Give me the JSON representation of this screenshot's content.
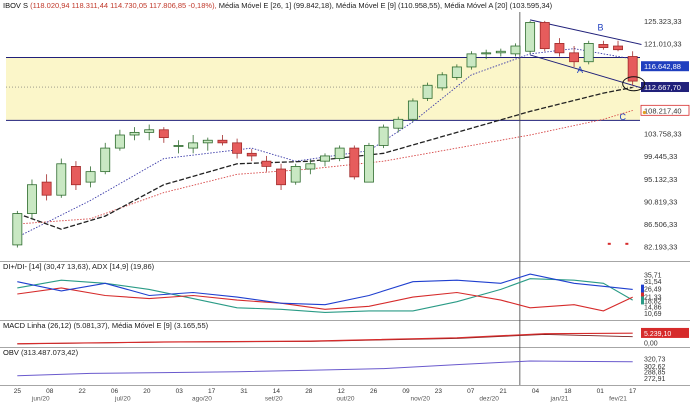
{
  "colors": {
    "up": "#c9e8c3",
    "up_edge": "#2e6b2e",
    "down": "#e65c5c",
    "down_edge": "#a12a2a",
    "zone": "#fbf6c9",
    "mme9": "#3a3aa8",
    "mme26": "#222222",
    "mma20": "#d64545",
    "di_plus": "#1f3fcf",
    "di_minus": "#d62b2b",
    "adx": "#2a9b86",
    "obv": "#6a5acd",
    "highlight_red": "#d62b2b",
    "highlight_blue": "#1f3fbf",
    "highlight_green": "#e6f2e0"
  },
  "legends": {
    "main": {
      "label": "IBOV S",
      "ohlc": "(118.020,94  118.311,44  114.730,05  117.806,85  -0,18%),",
      "mme26": "Média Móvel E [26, 1]  (99.842,18),",
      "mme9": "Média Móvel E [9]  (110.958,55),",
      "mma20": "Média Móvel A [20]  (103.595,34)"
    },
    "dmi": {
      "label": "DI+/DI- [14]",
      "di": "(30,47  13,63),",
      "adx": "ADX [14,9]  (19,86)"
    },
    "macd": {
      "label": "MACD Linha (26,12)",
      "line": "(5.081,37),",
      "mme": "Média Móvel E [9]  (3.165,55)"
    },
    "obv": {
      "label": "OBV",
      "value": "(313.487.073,42)"
    }
  },
  "axis": {
    "price_ticks": [
      "125.323,33",
      "121.010,33",
      "116.642,88",
      "112.667,70",
      "108.217,40",
      "103.758,33",
      "99.445,33",
      "95.132,33",
      "90.819,33",
      "86.506,33",
      "82.193,33"
    ],
    "dmi_ticks": [
      "35,71",
      "31,54",
      "26,49",
      "21,33",
      "18,82",
      "14,86",
      "10,69"
    ],
    "macd_ticks": [
      "5.239,10",
      "0,00"
    ],
    "obv_ticks": [
      "320,73",
      "302,62",
      "288,85",
      "272,91"
    ],
    "date_ticks": [
      "25",
      "08",
      "22",
      "06",
      "20",
      "03",
      "17",
      "31",
      "14",
      "28",
      "12",
      "26",
      "09",
      "23",
      "07",
      "21",
      "04",
      "18",
      "01",
      "17"
    ],
    "month_ticks": [
      "jun/20",
      "jul/20",
      "ago/20",
      "set/20",
      "out/20",
      "nov/20",
      "dez/20",
      "jan/21",
      "fev/21"
    ]
  },
  "annotations": {
    "wedge_a": "A",
    "wedge_b": "B",
    "wedge_c": "C"
  },
  "chart_data": {
    "type": "candlestick",
    "ylim": [
      80000,
      127000
    ],
    "highlight_levels": {
      "upper": 118300,
      "lower": 106300,
      "current": 112667.7,
      "blue": 116642.88,
      "red": 108217.4
    },
    "candles": [
      {
        "o": 82500,
        "h": 89000,
        "l": 82000,
        "c": 88500
      },
      {
        "o": 88500,
        "h": 95000,
        "l": 87500,
        "c": 94000
      },
      {
        "o": 94500,
        "h": 96000,
        "l": 91000,
        "c": 92000
      },
      {
        "o": 92000,
        "h": 99000,
        "l": 91500,
        "c": 98000
      },
      {
        "o": 97500,
        "h": 98500,
        "l": 93000,
        "c": 94000
      },
      {
        "o": 94500,
        "h": 97500,
        "l": 93500,
        "c": 96500
      },
      {
        "o": 96500,
        "h": 102000,
        "l": 96000,
        "c": 101000
      },
      {
        "o": 101000,
        "h": 104500,
        "l": 100500,
        "c": 103500
      },
      {
        "o": 103500,
        "h": 105000,
        "l": 102500,
        "c": 104000
      },
      {
        "o": 104000,
        "h": 105500,
        "l": 102500,
        "c": 104500
      },
      {
        "o": 104500,
        "h": 105000,
        "l": 102000,
        "c": 103000
      },
      {
        "o": 101500,
        "h": 102500,
        "l": 100000,
        "c": 101500
      },
      {
        "o": 101000,
        "h": 103500,
        "l": 100000,
        "c": 102000
      },
      {
        "o": 102000,
        "h": 103000,
        "l": 100500,
        "c": 102500
      },
      {
        "o": 102500,
        "h": 103500,
        "l": 101500,
        "c": 102000
      },
      {
        "o": 102000,
        "h": 102800,
        "l": 99000,
        "c": 100000
      },
      {
        "o": 100000,
        "h": 100800,
        "l": 98500,
        "c": 99500
      },
      {
        "o": 98500,
        "h": 99500,
        "l": 96500,
        "c": 97500
      },
      {
        "o": 97000,
        "h": 98000,
        "l": 93000,
        "c": 94000
      },
      {
        "o": 94500,
        "h": 98000,
        "l": 94000,
        "c": 97500
      },
      {
        "o": 97000,
        "h": 98800,
        "l": 96000,
        "c": 98000
      },
      {
        "o": 98500,
        "h": 100000,
        "l": 97500,
        "c": 99500
      },
      {
        "o": 99000,
        "h": 101500,
        "l": 98500,
        "c": 101000
      },
      {
        "o": 101000,
        "h": 101500,
        "l": 95000,
        "c": 95500
      },
      {
        "o": 94500,
        "h": 102000,
        "l": 94500,
        "c": 101500
      },
      {
        "o": 101500,
        "h": 105500,
        "l": 101000,
        "c": 105000
      },
      {
        "o": 104800,
        "h": 107000,
        "l": 104000,
        "c": 106500
      },
      {
        "o": 106500,
        "h": 110500,
        "l": 106000,
        "c": 110000
      },
      {
        "o": 110500,
        "h": 113500,
        "l": 110000,
        "c": 113000
      },
      {
        "o": 112500,
        "h": 115500,
        "l": 112000,
        "c": 115000
      },
      {
        "o": 114500,
        "h": 117000,
        "l": 114000,
        "c": 116500
      },
      {
        "o": 116500,
        "h": 119500,
        "l": 116000,
        "c": 119000
      },
      {
        "o": 119000,
        "h": 119800,
        "l": 118000,
        "c": 119200
      },
      {
        "o": 119200,
        "h": 120000,
        "l": 118500,
        "c": 119500
      },
      {
        "o": 119000,
        "h": 121000,
        "l": 118500,
        "c": 120500
      },
      {
        "o": 119500,
        "h": 125300,
        "l": 119000,
        "c": 125000
      },
      {
        "o": 125000,
        "h": 125300,
        "l": 119500,
        "c": 120000
      },
      {
        "o": 121000,
        "h": 122000,
        "l": 118500,
        "c": 119200
      },
      {
        "o": 119200,
        "h": 120500,
        "l": 116500,
        "c": 117500
      },
      {
        "o": 117500,
        "h": 121500,
        "l": 117000,
        "c": 121000
      },
      {
        "o": 120800,
        "h": 121500,
        "l": 119800,
        "c": 120200
      },
      {
        "o": 120500,
        "h": 121500,
        "l": 119500,
        "c": 119800
      },
      {
        "o": 118500,
        "h": 119500,
        "l": 113000,
        "c": 113800
      }
    ],
    "mme9": [
      [
        0,
        84000
      ],
      [
        5,
        91000
      ],
      [
        10,
        99000
      ],
      [
        16,
        101000
      ],
      [
        19,
        98500
      ],
      [
        24,
        100500
      ],
      [
        27,
        106000
      ],
      [
        31,
        115000
      ],
      [
        35,
        119000
      ],
      [
        38,
        120000
      ],
      [
        42,
        118000
      ]
    ],
    "mme26": [
      [
        0,
        88500
      ],
      [
        3,
        85500
      ],
      [
        6,
        88000
      ],
      [
        10,
        94000
      ],
      [
        15,
        98000
      ],
      [
        20,
        98500
      ],
      [
        25,
        100000
      ],
      [
        30,
        104000
      ],
      [
        35,
        108000
      ],
      [
        40,
        111500
      ],
      [
        42,
        112600
      ]
    ],
    "mma20": [
      [
        0,
        86500
      ],
      [
        5,
        87500
      ],
      [
        10,
        92500
      ],
      [
        15,
        96000
      ],
      [
        20,
        97000
      ],
      [
        25,
        98500
      ],
      [
        30,
        101000
      ],
      [
        35,
        103500
      ],
      [
        40,
        106500
      ],
      [
        42,
        108200
      ]
    ],
    "dmi": {
      "ylim": [
        8,
        38
      ],
      "di_plus": [
        [
          0,
          31
        ],
        [
          3,
          25
        ],
        [
          6,
          30
        ],
        [
          9,
          22
        ],
        [
          12,
          24
        ],
        [
          15,
          21
        ],
        [
          18,
          17
        ],
        [
          21,
          16
        ],
        [
          24,
          22
        ],
        [
          27,
          31
        ],
        [
          30,
          32
        ],
        [
          33,
          30
        ],
        [
          35,
          36
        ],
        [
          38,
          30
        ],
        [
          40,
          28
        ],
        [
          42,
          26
        ]
      ],
      "di_minus": [
        [
          0,
          23
        ],
        [
          3,
          27
        ],
        [
          6,
          22
        ],
        [
          9,
          20
        ],
        [
          12,
          22
        ],
        [
          15,
          19
        ],
        [
          18,
          17
        ],
        [
          21,
          13
        ],
        [
          24,
          15
        ],
        [
          27,
          21
        ],
        [
          30,
          24
        ],
        [
          33,
          19
        ],
        [
          35,
          14
        ],
        [
          38,
          16
        ],
        [
          40,
          12
        ],
        [
          42,
          21
        ]
      ],
      "adx": [
        [
          0,
          27
        ],
        [
          3,
          32
        ],
        [
          6,
          30
        ],
        [
          9,
          26
        ],
        [
          12,
          20
        ],
        [
          15,
          14
        ],
        [
          18,
          13
        ],
        [
          21,
          11
        ],
        [
          24,
          12
        ],
        [
          27,
          12
        ],
        [
          30,
          18
        ],
        [
          33,
          26
        ],
        [
          35,
          33
        ],
        [
          38,
          32
        ],
        [
          40,
          30
        ],
        [
          42,
          19
        ]
      ]
    },
    "macd": {
      "ylim": [
        -1500,
        8000
      ],
      "line": [
        [
          0,
          -800
        ],
        [
          10,
          200
        ],
        [
          20,
          700
        ],
        [
          30,
          2500
        ],
        [
          36,
          4800
        ],
        [
          42,
          5081
        ]
      ],
      "signal": [
        [
          0,
          -900
        ],
        [
          10,
          100
        ],
        [
          20,
          500
        ],
        [
          30,
          2200
        ],
        [
          36,
          4400
        ],
        [
          42,
          3165
        ]
      ]
    },
    "obv": {
      "ylim": [
        260,
        330
      ],
      "values": [
        [
          0,
          278
        ],
        [
          5,
          284
        ],
        [
          10,
          286
        ],
        [
          15,
          288
        ],
        [
          20,
          292
        ],
        [
          25,
          296
        ],
        [
          30,
          306
        ],
        [
          35,
          315
        ],
        [
          38,
          314
        ],
        [
          42,
          313
        ]
      ]
    }
  }
}
